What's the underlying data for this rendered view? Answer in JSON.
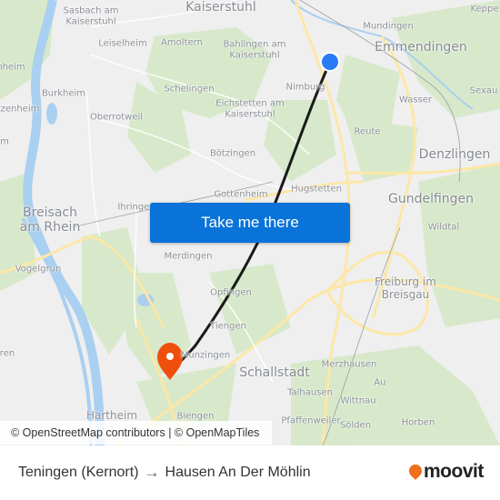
{
  "map": {
    "labels": [
      {
        "text": "Kaiserstuhl",
        "size": "lg"
      },
      {
        "text": "Sasbach am\nKaiserstuhl",
        "size": "sm"
      },
      {
        "text": "Leiselheim",
        "size": "sm"
      },
      {
        "text": "Amoltern",
        "size": "sm"
      },
      {
        "text": "Bahlingen am\nKaiserstuhl",
        "size": "sm"
      },
      {
        "text": "Mundingen",
        "size": "sm"
      },
      {
        "text": "Emmendingen",
        "size": "lg"
      },
      {
        "text": "Keppe",
        "size": "sm"
      },
      {
        "text": "nheim",
        "size": "sm"
      },
      {
        "text": "Burkheim",
        "size": "sm"
      },
      {
        "text": "Schelingen",
        "size": "sm"
      },
      {
        "text": "Nimburg",
        "size": "sm"
      },
      {
        "text": "Wasser",
        "size": "sm"
      },
      {
        "text": "Sexau",
        "size": "sm"
      },
      {
        "text": "tzenheim",
        "size": "sm"
      },
      {
        "text": "Oberrotweil",
        "size": "sm"
      },
      {
        "text": "Eichstetten am\nKaiserstuhl",
        "size": "sm"
      },
      {
        "text": "Reute",
        "size": "sm"
      },
      {
        "text": "m",
        "size": "sm"
      },
      {
        "text": "Bötzingen",
        "size": "sm"
      },
      {
        "text": "Denzlingen",
        "size": "lg"
      },
      {
        "text": "Gottenheim",
        "size": "sm"
      },
      {
        "text": "Hugstetten",
        "size": "sm"
      },
      {
        "text": "Gundelfingen",
        "size": "lg"
      },
      {
        "text": "Breisach\nam Rhein",
        "size": "lg"
      },
      {
        "text": "Ihringen",
        "size": "sm"
      },
      {
        "text": "Wildtal",
        "size": "sm"
      },
      {
        "text": "Vogelgrun",
        "size": "sm"
      },
      {
        "text": "Merdingen",
        "size": "sm"
      },
      {
        "text": "Freiburg im\nBreisgau",
        "size": "md"
      },
      {
        "text": "Opfingen",
        "size": "sm"
      },
      {
        "text": "Tiengen",
        "size": "sm"
      },
      {
        "text": "ren",
        "size": "sm"
      },
      {
        "text": "Munzingen",
        "size": "sm"
      },
      {
        "text": "Schallstadt",
        "size": "lg"
      },
      {
        "text": "Merzhausen",
        "size": "sm"
      },
      {
        "text": "Au",
        "size": "sm"
      },
      {
        "text": "Talhausen",
        "size": "sm"
      },
      {
        "text": "Wittnau",
        "size": "sm"
      },
      {
        "text": "Hartheim",
        "size": "md"
      },
      {
        "text": "Biengen",
        "size": "sm"
      },
      {
        "text": "Pfaffenweiler",
        "size": "sm"
      },
      {
        "text": "Sölden",
        "size": "sm"
      },
      {
        "text": "Horben",
        "size": "sm"
      }
    ],
    "origin_marker": {
      "color": "#2a7bf6"
    },
    "destination_marker": {
      "color": "#f04e0d"
    },
    "route_color": "#1a1a1a",
    "cta_label": "Take me there",
    "cta_color": "#0a73d9",
    "attribution": {
      "osm": "© OpenStreetMap contributors",
      "sep": " | ",
      "omt": "© OpenMapTiles"
    }
  },
  "footer": {
    "origin": "Teningen (Kernort)",
    "arrow_icon": "→",
    "destination": "Hausen An Der Möhlin",
    "brand": "moovit",
    "brand_color": "#f06e1d"
  }
}
